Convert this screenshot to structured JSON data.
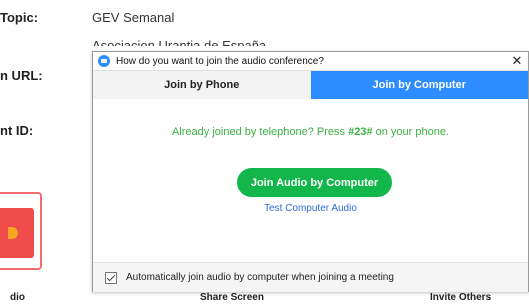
{
  "background": {
    "topic_label": "Topic:",
    "topic_value": "GEV Semanal",
    "host_value": "Asociacion Urantia de España",
    "url_label": "n URL:",
    "id_label": "nt ID:",
    "footer": {
      "audio_label": "dio",
      "share_label": "Share Screen",
      "invite_label": "Invite Others"
    }
  },
  "dialog": {
    "title": "How do you want to join the audio conference?",
    "close_glyph": "✕",
    "tabs": [
      {
        "label": "Join by Phone",
        "active": false
      },
      {
        "label": "Join by Computer",
        "active": true
      }
    ],
    "notice_prefix": "Already joined by telephone? Press ",
    "notice_code": "#23#",
    "notice_suffix": " on your phone.",
    "join_button_label": "Join Audio by Computer",
    "test_link_label": "Test Computer Audio",
    "auto_join": {
      "checked": true,
      "label": "Automatically join audio by computer when joining a meeting"
    }
  },
  "colors": {
    "accent_blue": "#2d8cff",
    "join_green": "#12b64b",
    "notice_green": "#3cb043",
    "link_blue": "#2d6fd6"
  },
  "icons": [
    "zoom-app-icon",
    "close-icon",
    "checkmark-icon"
  ]
}
